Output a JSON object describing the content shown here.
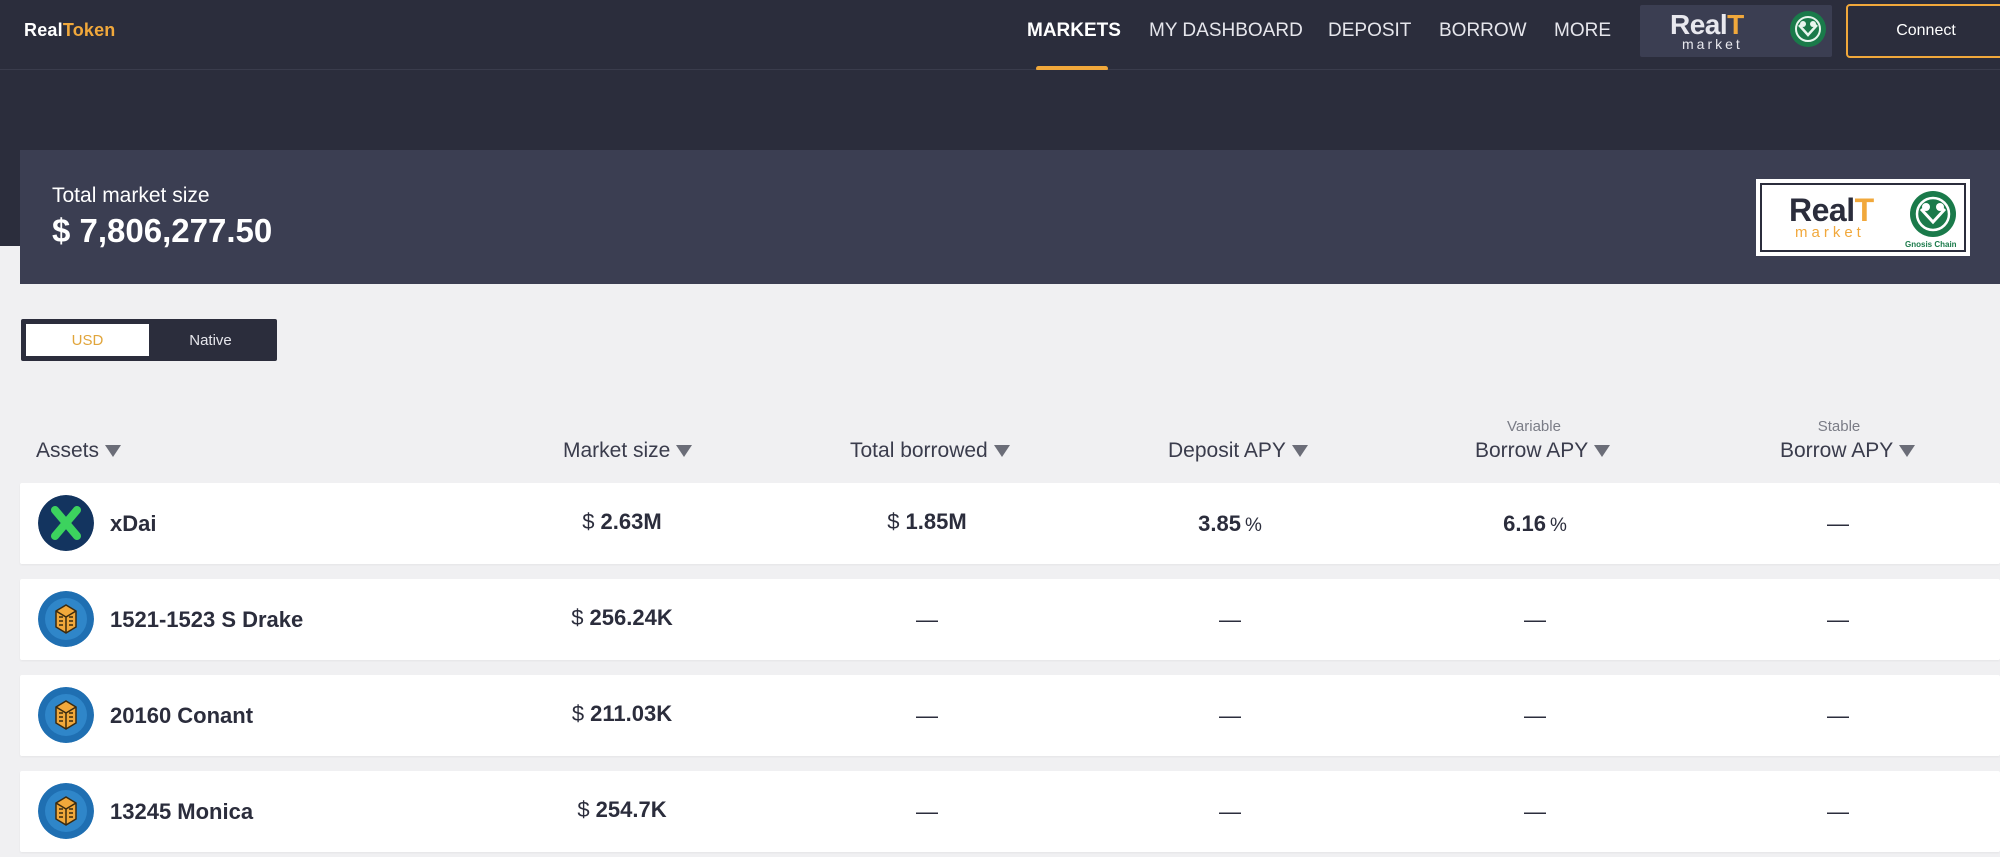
{
  "brand": {
    "name_a": "Real",
    "name_b": "T",
    "name_c": "oken"
  },
  "nav": {
    "items": [
      "MARKETS",
      "MY DASHBOARD",
      "DEPOSIT",
      "BORROW",
      "MORE"
    ],
    "active": "MARKETS"
  },
  "logo": {
    "realt_a": "Real",
    "realt_b": "T",
    "market": "market",
    "gnosis_label": "Gnosis Chain"
  },
  "connect_label": "Connect",
  "hero": {
    "label": "Total market size",
    "value": "$ 7,806,277.50"
  },
  "toggle": {
    "usd": "USD",
    "native": "Native",
    "selected": "USD"
  },
  "table": {
    "headers": {
      "assets": "Assets",
      "market_size": "Market size",
      "total_borrowed": "Total borrowed",
      "deposit_apy": "Deposit APY",
      "variable_sub": "Variable",
      "variable_borrow": "Borrow APY",
      "stable_sub": "Stable",
      "stable_borrow": "Borrow APY"
    },
    "rows": [
      {
        "name": "xDai",
        "icon": "xdai-icon",
        "market_size_symbol": "$",
        "market_size": "2.63M",
        "total_borrowed_symbol": "$",
        "total_borrowed": "1.85M",
        "deposit_apy": "3.85",
        "deposit_unit": "%",
        "variable_apy": "6.16",
        "variable_unit": "%",
        "stable_apy": "—"
      },
      {
        "name": "1521-1523 S Drake",
        "icon": "realtoken-building-icon",
        "market_size_symbol": "$",
        "market_size": "256.24K",
        "total_borrowed": "—",
        "deposit_apy": "—",
        "variable_apy": "—",
        "stable_apy": "—"
      },
      {
        "name": "20160 Conant",
        "icon": "realtoken-building-icon",
        "market_size_symbol": "$",
        "market_size": "211.03K",
        "total_borrowed": "—",
        "deposit_apy": "—",
        "variable_apy": "—",
        "stable_apy": "—"
      },
      {
        "name": "13245 Monica",
        "icon": "realtoken-building-icon",
        "market_size_symbol": "$",
        "market_size": "254.7K",
        "total_borrowed": "—",
        "deposit_apy": "—",
        "variable_apy": "—",
        "stable_apy": "—"
      }
    ]
  },
  "colors": {
    "header_bg": "#2b2d3c",
    "card_bg": "#3b3e52",
    "accent": "#f1a83b",
    "page_bg": "#f0f0f2"
  }
}
